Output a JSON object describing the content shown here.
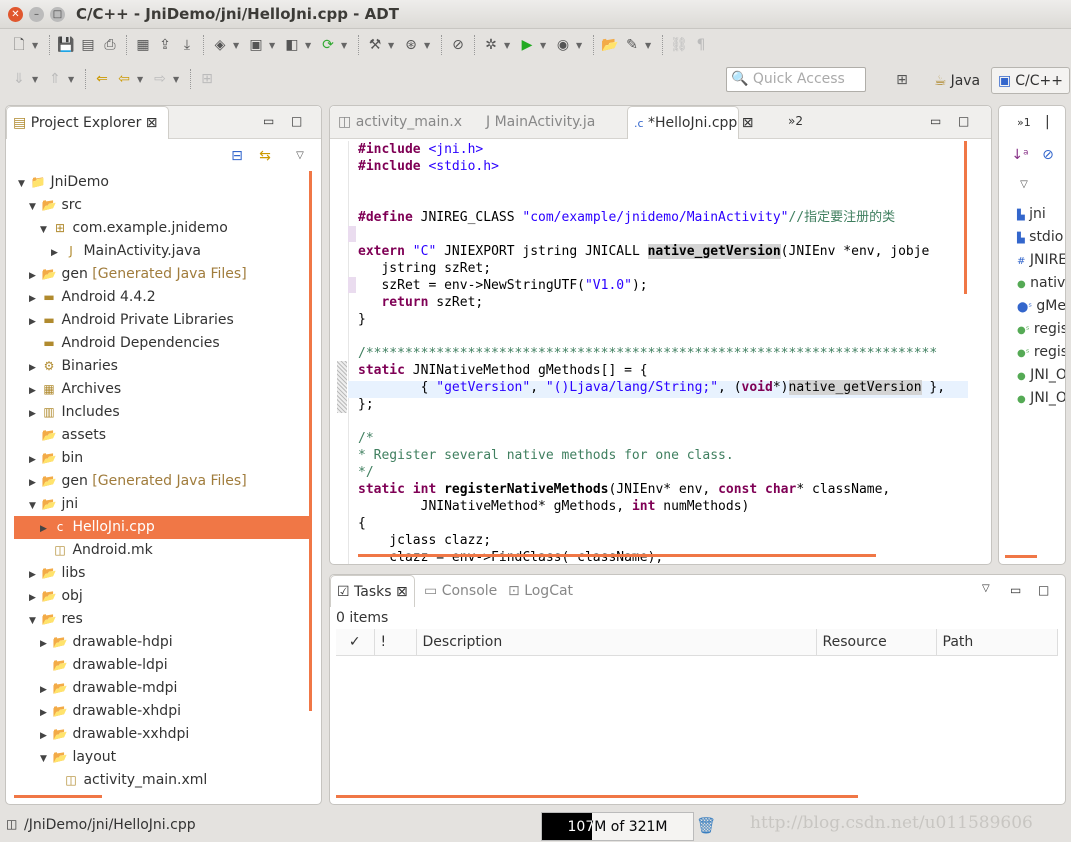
{
  "window": {
    "title": "C/C++ - JniDemo/jni/HelloJni.cpp - ADT"
  },
  "toolbar": {
    "quick_access_placeholder": "Quick Access",
    "perspectives": [
      {
        "label": "Java"
      },
      {
        "label": "C/C++",
        "active": true
      }
    ]
  },
  "project_explorer": {
    "title": "Project Explorer",
    "items": [
      {
        "label": "JniDemo",
        "level": 0,
        "arrow": "open",
        "icon": "project"
      },
      {
        "label": "src",
        "level": 1,
        "arrow": "open",
        "icon": "folder"
      },
      {
        "label": "com.example.jnidemo",
        "level": 2,
        "arrow": "open",
        "icon": "package"
      },
      {
        "label": "MainActivity.java",
        "level": 3,
        "arrow": "closed",
        "icon": "java-file"
      },
      {
        "label": "gen",
        "deco": "[Generated Java Files]",
        "level": 1,
        "arrow": "closed",
        "icon": "folder"
      },
      {
        "label": "Android 4.4.2",
        "level": 1,
        "arrow": "closed",
        "icon": "library"
      },
      {
        "label": "Android Private Libraries",
        "level": 1,
        "arrow": "closed",
        "icon": "library"
      },
      {
        "label": "Android Dependencies",
        "level": 1,
        "arrow": "none",
        "icon": "library"
      },
      {
        "label": "Binaries",
        "level": 1,
        "arrow": "closed",
        "icon": "binaries"
      },
      {
        "label": "Archives",
        "level": 1,
        "arrow": "closed",
        "icon": "archives"
      },
      {
        "label": "Includes",
        "level": 1,
        "arrow": "closed",
        "icon": "includes"
      },
      {
        "label": "assets",
        "level": 1,
        "arrow": "none",
        "icon": "folder"
      },
      {
        "label": "bin",
        "level": 1,
        "arrow": "closed",
        "icon": "folder"
      },
      {
        "label": "gen",
        "deco": "[Generated Java Files]",
        "level": 1,
        "arrow": "closed",
        "icon": "folder"
      },
      {
        "label": "jni",
        "level": 1,
        "arrow": "open",
        "icon": "folder"
      },
      {
        "label": "HelloJni.cpp",
        "level": 2,
        "arrow": "closed",
        "icon": "cpp-file",
        "selected": true
      },
      {
        "label": "Android.mk",
        "level": 2,
        "arrow": "none",
        "icon": "file"
      },
      {
        "label": "libs",
        "level": 1,
        "arrow": "closed",
        "icon": "folder"
      },
      {
        "label": "obj",
        "level": 1,
        "arrow": "closed",
        "icon": "folder"
      },
      {
        "label": "res",
        "level": 1,
        "arrow": "open",
        "icon": "folder"
      },
      {
        "label": "drawable-hdpi",
        "level": 2,
        "arrow": "closed",
        "icon": "folder"
      },
      {
        "label": "drawable-ldpi",
        "level": 2,
        "arrow": "none",
        "icon": "folder"
      },
      {
        "label": "drawable-mdpi",
        "level": 2,
        "arrow": "closed",
        "icon": "folder"
      },
      {
        "label": "drawable-xhdpi",
        "level": 2,
        "arrow": "closed",
        "icon": "folder"
      },
      {
        "label": "drawable-xxhdpi",
        "level": 2,
        "arrow": "closed",
        "icon": "folder"
      },
      {
        "label": "layout",
        "level": 2,
        "arrow": "open",
        "icon": "folder"
      },
      {
        "label": "activity_main.xml",
        "level": 3,
        "arrow": "none",
        "icon": "xml-file"
      }
    ]
  },
  "editor": {
    "tabs": [
      {
        "label": "activity_main.x"
      },
      {
        "label": "MainActivity.ja"
      },
      {
        "label": "*HelloJni.cpp",
        "active": true
      }
    ],
    "overflow": "»2",
    "lines": [
      [
        [
          "k",
          "#include"
        ],
        [
          "",
          " "
        ],
        [
          "s",
          "<jni.h>"
        ]
      ],
      [
        [
          "k",
          "#include"
        ],
        [
          "",
          " "
        ],
        [
          "s",
          "<stdio.h>"
        ]
      ],
      [],
      [],
      [
        [
          "k",
          "#define"
        ],
        [
          "",
          " JNIREG_CLASS "
        ],
        [
          "s",
          "\"com/example/jnidemo/MainActivity\""
        ],
        [
          "c",
          "//指定要注册的类"
        ]
      ],
      [],
      [
        [
          "k",
          "extern"
        ],
        [
          "",
          " "
        ],
        [
          "s",
          "\"C\""
        ],
        [
          "",
          " JNIEXPORT jstring JNICALL "
        ],
        [
          "f hl",
          "native_getVersion"
        ],
        [
          "",
          "(JNIEnv *env, jobje"
        ]
      ],
      [
        [
          "",
          "   jstring szRet;"
        ]
      ],
      [
        [
          "",
          "   szRet = env->NewStringUTF("
        ],
        [
          "s",
          "\"V1.0\""
        ],
        [
          "",
          ");"
        ]
      ],
      [
        [
          "",
          "   "
        ],
        [
          "k",
          "return"
        ],
        [
          "",
          " szRet;"
        ]
      ],
      [
        [
          "",
          "}"
        ]
      ],
      [],
      [
        [
          "c",
          "/*************************************************************************"
        ]
      ],
      [
        [
          "k",
          "static"
        ],
        [
          "",
          " JNINativeMethod gMethods[] = {"
        ]
      ],
      [
        [
          "",
          "        { "
        ],
        [
          "s",
          "\"getVersion\""
        ],
        [
          "",
          ", "
        ],
        [
          "s",
          "\"()Ljava/lang/String;\""
        ],
        [
          "",
          ", ("
        ],
        [
          "k",
          "void"
        ],
        [
          "",
          "*)"
        ],
        [
          "hl",
          "native_getVersion"
        ],
        [
          "",
          " },"
        ]
      ],
      [
        [
          "",
          "};"
        ]
      ],
      [],
      [
        [
          "c",
          "/*"
        ]
      ],
      [
        [
          "c",
          "* Register several native methods for one class."
        ]
      ],
      [
        [
          "c",
          "*/"
        ]
      ],
      [
        [
          "k",
          "static"
        ],
        [
          "",
          " "
        ],
        [
          "k",
          "int"
        ],
        [
          "",
          " "
        ],
        [
          "f",
          "registerNativeMethods"
        ],
        [
          "",
          "(JNIEnv* env, "
        ],
        [
          "k",
          "const"
        ],
        [
          "",
          " "
        ],
        [
          "k",
          "char"
        ],
        [
          "",
          "* className,"
        ]
      ],
      [
        [
          "",
          "        JNINativeMethod* gMethods, "
        ],
        [
          "k",
          "int"
        ],
        [
          "",
          " numMethods)"
        ]
      ],
      [
        [
          "",
          "{"
        ]
      ],
      [
        [
          "",
          "    jclass clazz;"
        ]
      ],
      [
        [
          "",
          "    clazz = env->FindClass( className);"
        ]
      ]
    ]
  },
  "outline": {
    "overflow": "»1",
    "items": [
      {
        "label": "jni",
        "icon": "include-icon"
      },
      {
        "label": "stdio",
        "icon": "include-icon"
      },
      {
        "label": "JNIREG_CLASS",
        "icon": "macro-icon"
      },
      {
        "label": "native_getVersion",
        "icon": "function-icon"
      },
      {
        "label": "gMethods",
        "icon": "static-variable-icon"
      },
      {
        "label": "registerNativeMethods",
        "icon": "static-function-icon"
      },
      {
        "label": "registerNatives",
        "icon": "static-function-icon"
      },
      {
        "label": "JNI_OnLoad",
        "icon": "function-icon"
      },
      {
        "label": "JNI_OnUnload",
        "icon": "function-icon"
      }
    ]
  },
  "bottom": {
    "tabs": [
      {
        "label": "Tasks",
        "active": true
      },
      {
        "label": "Console"
      },
      {
        "label": "LogCat"
      }
    ],
    "count": "0 items",
    "columns": [
      "✓",
      "!",
      "Description",
      "Resource",
      "Path"
    ]
  },
  "status": {
    "path": "/JniDemo/jni/HelloJni.cpp",
    "heap": "107M of 321M",
    "heap_used_fraction": 0.333,
    "watermark": "http://blog.csdn.net/u011589606"
  },
  "colors": {
    "accent": "#f07746",
    "keyword": "#7f0055",
    "string": "#2a00ff",
    "comment": "#3f7f5f"
  }
}
